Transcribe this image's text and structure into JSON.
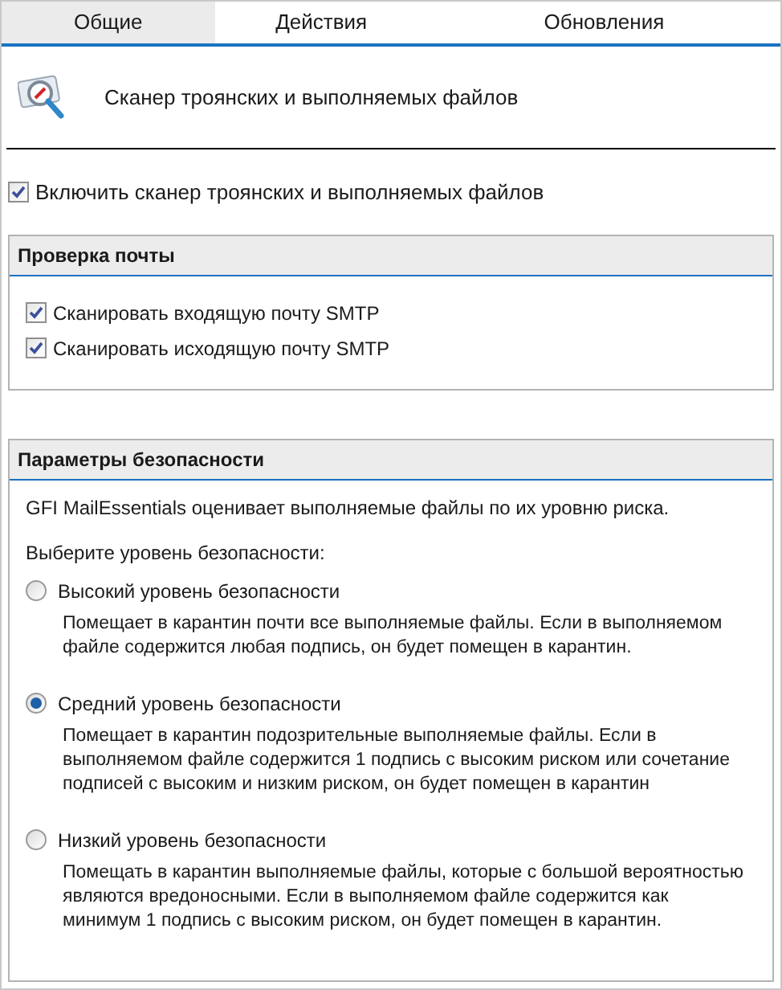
{
  "tabs": [
    {
      "label": "Общие",
      "selected": true
    },
    {
      "label": "Действия",
      "selected": false
    },
    {
      "label": "Обновления",
      "selected": false
    }
  ],
  "header": {
    "title": "Сканер троянских и выполняемых файлов"
  },
  "enable": {
    "label": "Включить сканер троянских и выполняемых файлов",
    "checked": true
  },
  "mail_check": {
    "title": "Проверка почты",
    "options": [
      {
        "label": "Сканировать входящую почту SMTP",
        "checked": true
      },
      {
        "label": "Сканировать исходящую почту SMTP",
        "checked": true
      }
    ]
  },
  "security": {
    "title": "Параметры безопасности",
    "intro": "GFI MailEssentials оценивает выполняемые файлы по их уровню риска.",
    "prompt": "Выберите уровень безопасности:",
    "levels": [
      {
        "label": "Высокий уровень безопасности",
        "selected": false,
        "description": "Помещает в карантин почти все выполняемые файлы. Если в выполняемом файле содержится любая подпись, он будет помещен в карантин."
      },
      {
        "label": "Средний уровень безопасности",
        "selected": true,
        "description": "Помещает в карантин подозрительные выполняемые файлы. Если в выполняемом файле содержится 1 подпись с высоким риском или сочетание подписей с высоким и низким риском, он будет помещен в карантин"
      },
      {
        "label": "Низкий уровень безопасности",
        "selected": false,
        "description": "Помещать в карантин выполняемые файлы, которые с большой вероятностью являются вредоносными. Если в выполняемом файле содержится как минимум 1 подпись с высоким риском, он будет помещен в карантин."
      }
    ]
  }
}
